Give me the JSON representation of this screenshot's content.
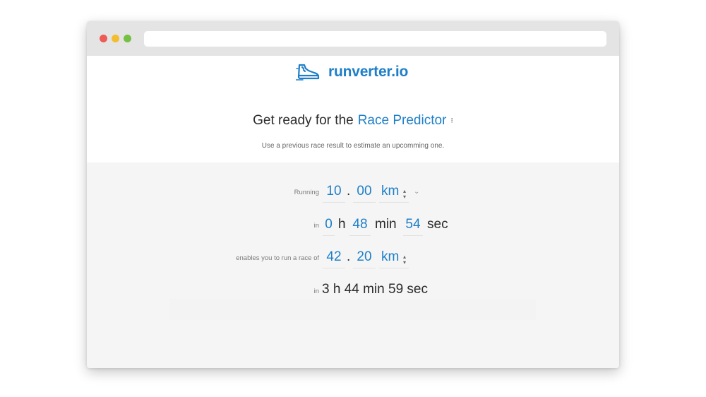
{
  "brand": {
    "logo_icon": "running-shoe-icon",
    "name": "runverter.io",
    "color": "#1e7fc8"
  },
  "headline": {
    "prefix": "Get ready for the",
    "tool": "Race Predictor",
    "selector_icon": "⁝"
  },
  "subtitle": "Use a previous race result to estimate an upcomming one.",
  "form": {
    "running_label": "Running",
    "distance_int": "10",
    "distance_sep": ".",
    "distance_dec": "00",
    "distance_unit": "km",
    "in_label": "in",
    "time_hours": "0",
    "hours_unit": "h",
    "time_minutes": "48",
    "minutes_unit": "min",
    "time_seconds": "54",
    "seconds_unit": "sec",
    "target_label": "enables you to run a race of",
    "target_int": "42",
    "target_sep": ".",
    "target_dec": "20",
    "target_unit": "km",
    "result_label": "in",
    "result": "3 h 44 min 59 sec"
  }
}
